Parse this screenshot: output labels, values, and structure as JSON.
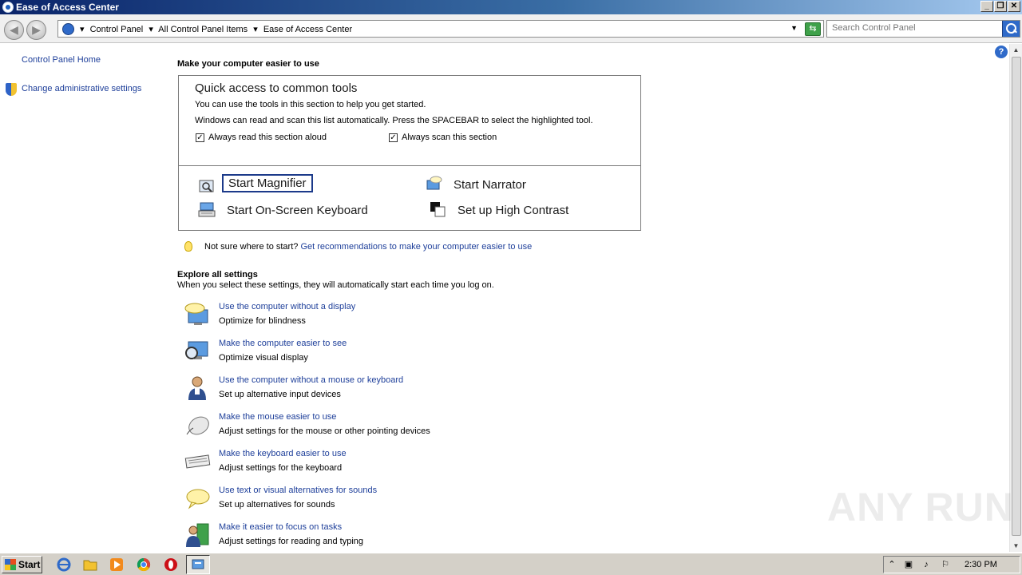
{
  "window": {
    "title": "Ease of Access Center"
  },
  "address": {
    "crumbs": [
      "Control Panel",
      "All Control Panel Items",
      "Ease of Access Center"
    ],
    "search_placeholder": "Search Control Panel"
  },
  "left_pane": {
    "home_link": "Control Panel Home",
    "admin_link": "Change administrative settings"
  },
  "main": {
    "heading": "Make your computer easier to use",
    "quick_access": {
      "title": "Quick access to common tools",
      "line1": "You can use the tools in this section to help you get started.",
      "line2": "Windows can read and scan this list automatically.  Press the SPACEBAR to select the highlighted tool.",
      "check_read": {
        "label": "Always read this section aloud",
        "checked": true
      },
      "check_scan": {
        "label": "Always scan this section",
        "checked": true
      },
      "tools": {
        "magnifier": "Start Magnifier",
        "narrator": "Start Narrator",
        "keyboard": "Start On-Screen Keyboard",
        "contrast": "Set up High Contrast"
      }
    },
    "not_sure": {
      "prefix": "Not sure where to start?",
      "link": "Get recommendations to make your computer easier to use"
    },
    "explore": {
      "title": "Explore all settings",
      "description": "When you select these settings, they will automatically start each time you log on.",
      "items": [
        {
          "title": "Use the computer without a display",
          "desc": "Optimize for blindness",
          "icon": "display-speech-icon"
        },
        {
          "title": "Make the computer easier to see",
          "desc": "Optimize visual display",
          "icon": "monitor-magnifier-icon"
        },
        {
          "title": "Use the computer without a mouse or keyboard",
          "desc": "Set up alternative input devices",
          "icon": "person-icon"
        },
        {
          "title": "Make the mouse easier to use",
          "desc": "Adjust settings for the mouse or other pointing devices",
          "icon": "mouse-icon"
        },
        {
          "title": "Make the keyboard easier to use",
          "desc": "Adjust settings for the keyboard",
          "icon": "keyboard-icon"
        },
        {
          "title": "Use text or visual alternatives for sounds",
          "desc": "Set up alternatives for sounds",
          "icon": "speech-bubble-icon"
        },
        {
          "title": "Make it easier to focus on tasks",
          "desc": "Adjust settings for reading and typing",
          "icon": "person-green-icon"
        }
      ]
    }
  },
  "taskbar": {
    "start_label": "Start",
    "clock": "2:30 PM"
  },
  "watermark": "ANY RUN",
  "colors": {
    "link": "#1e3f9a",
    "title_bar": "#0a246a",
    "taskbar": "#d4d0c8"
  }
}
